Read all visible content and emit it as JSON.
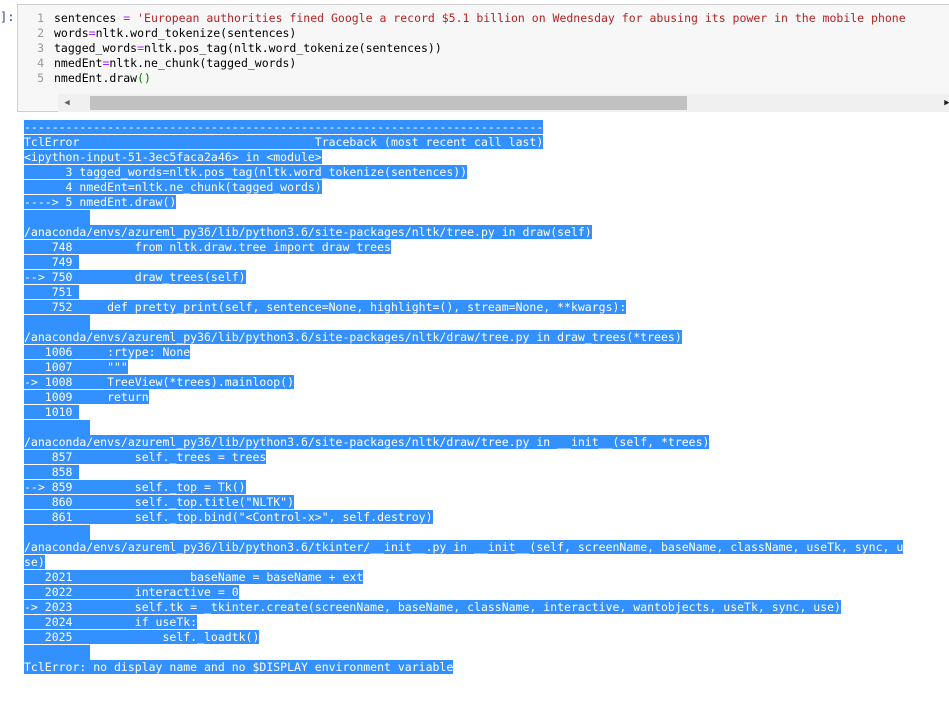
{
  "prompt_mark": "]:",
  "code_cell": {
    "lines": [
      {
        "num": "1",
        "parts": [
          [
            "t",
            "sentences "
          ],
          [
            "op",
            "="
          ],
          [
            "t",
            " "
          ],
          [
            "str",
            "'European authorities fined Google a record $5.1 billion on Wednesday for abusing its power in the mobile phone"
          ]
        ]
      },
      {
        "num": "2",
        "parts": [
          [
            "t",
            "words"
          ],
          [
            "op",
            "="
          ],
          [
            "t",
            "nltk.word_tokenize(sentences)"
          ]
        ]
      },
      {
        "num": "3",
        "parts": [
          [
            "t",
            "tagged_words"
          ],
          [
            "op",
            "="
          ],
          [
            "t",
            "nltk.pos_tag(nltk.word_tokenize(sentences))"
          ]
        ]
      },
      {
        "num": "4",
        "parts": [
          [
            "t",
            "nmedEnt"
          ],
          [
            "op",
            "="
          ],
          [
            "t",
            "nltk.ne_chunk(tagged_words)"
          ]
        ]
      },
      {
        "num": "5",
        "parts": [
          [
            "t",
            "nmedEnt.draw"
          ],
          [
            "fn",
            "()"
          ]
        ]
      }
    ],
    "scroll_left_glyph": "◀",
    "scroll_right_glyph": "▶"
  },
  "traceback": {
    "lines": [
      "---------------------------------------------------------------------------",
      "TclError                                  Traceback (most recent call last)",
      "<ipython-input-51-3ec5faca2a46> in <module>",
      "      3 tagged_words=nltk.pos_tag(nltk.word_tokenize(sentences))",
      "      4 nmedEnt=nltk.ne_chunk(tagged_words)",
      "----> 5 nmedEnt.draw()",
      "",
      "/anaconda/envs/azureml_py36/lib/python3.6/site-packages/nltk/tree.py in draw(self)",
      "    748         from nltk.draw.tree import draw_trees",
      "    749 ",
      "--> 750         draw_trees(self)",
      "    751 ",
      "    752     def pretty_print(self, sentence=None, highlight=(), stream=None, **kwargs):",
      "",
      "/anaconda/envs/azureml_py36/lib/python3.6/site-packages/nltk/draw/tree.py in draw_trees(*trees)",
      "   1006     :rtype: None",
      "   1007     \"\"\"",
      "-> 1008     TreeView(*trees).mainloop()",
      "   1009     return",
      "   1010 ",
      "",
      "/anaconda/envs/azureml_py36/lib/python3.6/site-packages/nltk/draw/tree.py in __init__(self, *trees)",
      "    857         self._trees = trees",
      "    858 ",
      "--> 859         self._top = Tk()",
      "    860         self._top.title(\"NLTK\")",
      "    861         self._top.bind(\"<Control-x>\", self.destroy)",
      "",
      "/anaconda/envs/azureml_py36/lib/python3.6/tkinter/__init__.py in __init__(self, screenName, baseName, className, useTk, sync, u",
      "se)",
      "   2021                 baseName = baseName + ext",
      "   2022         interactive = 0",
      "-> 2023         self.tk = _tkinter.create(screenName, baseName, className, interactive, wantobjects, useTk, sync, use)",
      "   2024         if useTk:",
      "   2025             self._loadtk()",
      "",
      "TclError: no display name and no $DISPLAY environment variable"
    ]
  }
}
